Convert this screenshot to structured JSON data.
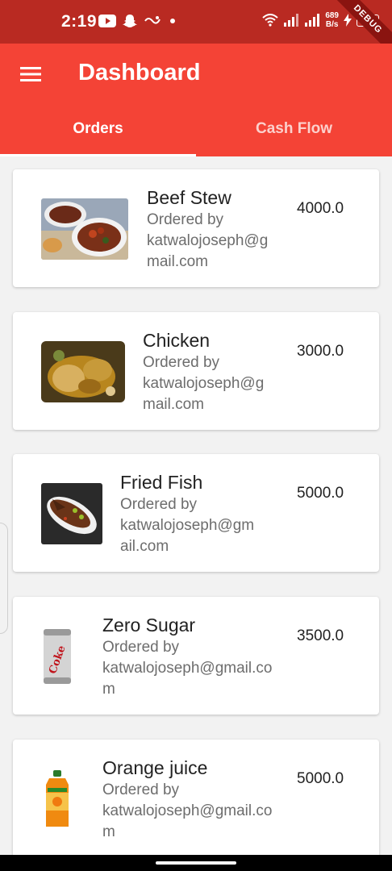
{
  "status_bar": {
    "time": "2:19",
    "net_speed_value": "689",
    "net_speed_unit": "B/s",
    "battery": "68",
    "debug_label": "DEBUG",
    "icons": [
      "youtube-icon",
      "snapchat-icon",
      "app-icon",
      "dot-icon",
      "wifi-icon",
      "signal-icon",
      "signal-icon",
      "charging-icon",
      "battery-icon"
    ]
  },
  "app_bar": {
    "title": "Dashboard",
    "menu_icon": "menu-icon",
    "tabs": [
      {
        "label": "Orders",
        "active": true
      },
      {
        "label": "Cash Flow",
        "active": false
      }
    ]
  },
  "orders": [
    {
      "name": "Beef Stew",
      "ordered_by_label": "Ordered by",
      "email": "katwalojoseph@gmail.com",
      "price": "4000.0",
      "image": "beef-stew-image"
    },
    {
      "name": "Chicken",
      "ordered_by_label": "Ordered by",
      "email": "katwalojoseph@gmail.com",
      "price": "3000.0",
      "image": "chicken-image"
    },
    {
      "name": "Fried Fish",
      "ordered_by_label": "Ordered by",
      "email": "katwalojoseph@gmail.com",
      "price": "5000.0",
      "image": "fried-fish-image"
    },
    {
      "name": "Zero Sugar",
      "ordered_by_label": "Ordered by",
      "email": "katwalojoseph@gmail.com",
      "price": "3500.0",
      "image": "coke-can-image"
    },
    {
      "name": "Orange juice",
      "ordered_by_label": "Ordered by",
      "email": "katwalojoseph@gmail.com",
      "price": "5000.0",
      "image": "orange-juice-image"
    }
  ],
  "colors": {
    "status_bar": "#b92a22",
    "app_bar": "#f44336",
    "background": "#f2f2f2"
  }
}
